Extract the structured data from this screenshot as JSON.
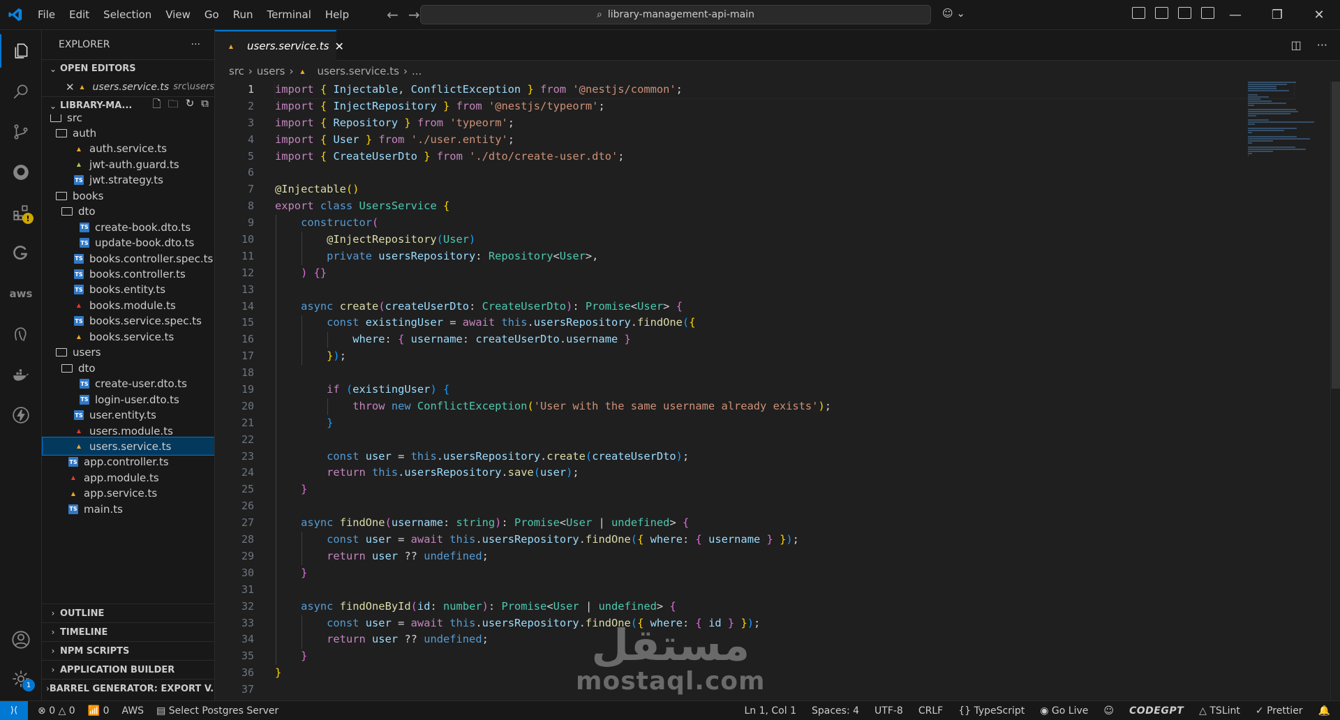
{
  "menu": [
    "File",
    "Edit",
    "Selection",
    "View",
    "Go",
    "Run",
    "Terminal",
    "Help"
  ],
  "command_center": {
    "text": "library-management-api-main"
  },
  "sidebar": {
    "title": "EXPLORER",
    "open_editors": {
      "label": "OPEN EDITORS",
      "items": [
        {
          "name": "users.service.ts",
          "path": "src\\users"
        }
      ]
    },
    "workspace_label": "LIBRARY-MA...",
    "tree": [
      {
        "label": "src",
        "kind": "folder",
        "depth": 0
      },
      {
        "label": "auth",
        "kind": "folder",
        "depth": 1
      },
      {
        "label": "auth.service.ts",
        "kind": "ng-y",
        "depth": 2
      },
      {
        "label": "jwt-auth.guard.ts",
        "kind": "guard",
        "depth": 2
      },
      {
        "label": "jwt.strategy.ts",
        "kind": "ts",
        "depth": 2
      },
      {
        "label": "books",
        "kind": "folder",
        "depth": 1
      },
      {
        "label": "dto",
        "kind": "folder",
        "depth": 2
      },
      {
        "label": "create-book.dto.ts",
        "kind": "ts",
        "depth": 3
      },
      {
        "label": "update-book.dto.ts",
        "kind": "ts",
        "depth": 3
      },
      {
        "label": "books.controller.spec.ts",
        "kind": "ts",
        "depth": 2
      },
      {
        "label": "books.controller.ts",
        "kind": "ts",
        "depth": 2
      },
      {
        "label": "books.entity.ts",
        "kind": "ts",
        "depth": 2
      },
      {
        "label": "books.module.ts",
        "kind": "ng-r",
        "depth": 2
      },
      {
        "label": "books.service.spec.ts",
        "kind": "ts",
        "depth": 2
      },
      {
        "label": "books.service.ts",
        "kind": "ng-y",
        "depth": 2
      },
      {
        "label": "users",
        "kind": "folder",
        "depth": 1
      },
      {
        "label": "dto",
        "kind": "folder",
        "depth": 2
      },
      {
        "label": "create-user.dto.ts",
        "kind": "ts",
        "depth": 3
      },
      {
        "label": "login-user.dto.ts",
        "kind": "ts",
        "depth": 3
      },
      {
        "label": "user.entity.ts",
        "kind": "ts",
        "depth": 2
      },
      {
        "label": "users.module.ts",
        "kind": "ng-r",
        "depth": 2
      },
      {
        "label": "users.service.ts",
        "kind": "ng-y",
        "depth": 2,
        "selected": true
      },
      {
        "label": "app.controller.ts",
        "kind": "ts",
        "depth": 1
      },
      {
        "label": "app.module.ts",
        "kind": "ng-r",
        "depth": 1
      },
      {
        "label": "app.service.ts",
        "kind": "ng-y",
        "depth": 1
      },
      {
        "label": "main.ts",
        "kind": "ts",
        "depth": 1
      }
    ],
    "sections": [
      "OUTLINE",
      "TIMELINE",
      "NPM SCRIPTS",
      "APPLICATION BUILDER",
      "BARREL GENERATOR: EXPORT V..."
    ]
  },
  "editor": {
    "tab": "users.service.ts",
    "breadcrumb": [
      "src",
      "users",
      "users.service.ts",
      "..."
    ],
    "current_line": 1,
    "lines": [
      [
        [
          "k",
          "import"
        ],
        [
          "p",
          " "
        ],
        [
          "b1",
          "{"
        ],
        [
          "p",
          " "
        ],
        [
          "v",
          "Injectable"
        ],
        [
          "p",
          ", "
        ],
        [
          "v",
          "ConflictException"
        ],
        [
          "p",
          " "
        ],
        [
          "b1",
          "}"
        ],
        [
          "p",
          " "
        ],
        [
          "k",
          "from"
        ],
        [
          "p",
          " "
        ],
        [
          "s",
          "'@nestjs/common'"
        ],
        [
          "p",
          ";"
        ]
      ],
      [
        [
          "k",
          "import"
        ],
        [
          "p",
          " "
        ],
        [
          "b1",
          "{"
        ],
        [
          "p",
          " "
        ],
        [
          "v",
          "InjectRepository"
        ],
        [
          "p",
          " "
        ],
        [
          "b1",
          "}"
        ],
        [
          "p",
          " "
        ],
        [
          "k",
          "from"
        ],
        [
          "p",
          " "
        ],
        [
          "s",
          "'@nestjs/typeorm'"
        ],
        [
          "p",
          ";"
        ]
      ],
      [
        [
          "k",
          "import"
        ],
        [
          "p",
          " "
        ],
        [
          "b1",
          "{"
        ],
        [
          "p",
          " "
        ],
        [
          "v",
          "Repository"
        ],
        [
          "p",
          " "
        ],
        [
          "b1",
          "}"
        ],
        [
          "p",
          " "
        ],
        [
          "k",
          "from"
        ],
        [
          "p",
          " "
        ],
        [
          "s",
          "'typeorm'"
        ],
        [
          "p",
          ";"
        ]
      ],
      [
        [
          "k",
          "import"
        ],
        [
          "p",
          " "
        ],
        [
          "b1",
          "{"
        ],
        [
          "p",
          " "
        ],
        [
          "v",
          "User"
        ],
        [
          "p",
          " "
        ],
        [
          "b1",
          "}"
        ],
        [
          "p",
          " "
        ],
        [
          "k",
          "from"
        ],
        [
          "p",
          " "
        ],
        [
          "s",
          "'./user.entity'"
        ],
        [
          "p",
          ";"
        ]
      ],
      [
        [
          "k",
          "import"
        ],
        [
          "p",
          " "
        ],
        [
          "b1",
          "{"
        ],
        [
          "p",
          " "
        ],
        [
          "v",
          "CreateUserDto"
        ],
        [
          "p",
          " "
        ],
        [
          "b1",
          "}"
        ],
        [
          "p",
          " "
        ],
        [
          "k",
          "from"
        ],
        [
          "p",
          " "
        ],
        [
          "s",
          "'./dto/create-user.dto'"
        ],
        [
          "p",
          ";"
        ]
      ],
      [],
      [
        [
          "f",
          "@Injectable"
        ],
        [
          "b1",
          "()"
        ]
      ],
      [
        [
          "k",
          "export"
        ],
        [
          "p",
          " "
        ],
        [
          "kw",
          "class"
        ],
        [
          "p",
          " "
        ],
        [
          "t",
          "UsersService"
        ],
        [
          "p",
          " "
        ],
        [
          "b1",
          "{"
        ]
      ],
      [
        [
          "p",
          "    "
        ],
        [
          "kw",
          "constructor"
        ],
        [
          "b2",
          "("
        ]
      ],
      [
        [
          "p",
          "        "
        ],
        [
          "f",
          "@InjectRepository"
        ],
        [
          "b3",
          "("
        ],
        [
          "t",
          "User"
        ],
        [
          "b3",
          ")"
        ]
      ],
      [
        [
          "p",
          "        "
        ],
        [
          "kw",
          "private"
        ],
        [
          "p",
          " "
        ],
        [
          "v",
          "usersRepository"
        ],
        [
          "p",
          ": "
        ],
        [
          "t",
          "Repository"
        ],
        [
          "p",
          "<"
        ],
        [
          "t",
          "User"
        ],
        [
          "p",
          ">,"
        ]
      ],
      [
        [
          "p",
          "    "
        ],
        [
          "b2",
          ")"
        ],
        [
          "p",
          " "
        ],
        [
          "b2",
          "{}"
        ]
      ],
      [],
      [
        [
          "p",
          "    "
        ],
        [
          "kw",
          "async"
        ],
        [
          "p",
          " "
        ],
        [
          "f",
          "create"
        ],
        [
          "b2",
          "("
        ],
        [
          "v",
          "createUserDto"
        ],
        [
          "p",
          ": "
        ],
        [
          "t",
          "CreateUserDto"
        ],
        [
          "b2",
          ")"
        ],
        [
          "p",
          ": "
        ],
        [
          "t",
          "Promise"
        ],
        [
          "p",
          "<"
        ],
        [
          "t",
          "User"
        ],
        [
          "p",
          "> "
        ],
        [
          "b2",
          "{"
        ]
      ],
      [
        [
          "p",
          "        "
        ],
        [
          "kw",
          "const"
        ],
        [
          "p",
          " "
        ],
        [
          "v",
          "existingUser"
        ],
        [
          "p",
          " = "
        ],
        [
          "k",
          "await"
        ],
        [
          "p",
          " "
        ],
        [
          "kw",
          "this"
        ],
        [
          "p",
          "."
        ],
        [
          "v",
          "usersRepository"
        ],
        [
          "p",
          "."
        ],
        [
          "f",
          "findOne"
        ],
        [
          "b3",
          "("
        ],
        [
          "b1",
          "{"
        ]
      ],
      [
        [
          "p",
          "            "
        ],
        [
          "v",
          "where"
        ],
        [
          "p",
          ": "
        ],
        [
          "b2",
          "{"
        ],
        [
          "p",
          " "
        ],
        [
          "v",
          "username"
        ],
        [
          "p",
          ": "
        ],
        [
          "v",
          "createUserDto"
        ],
        [
          "p",
          "."
        ],
        [
          "v",
          "username"
        ],
        [
          "p",
          " "
        ],
        [
          "b2",
          "}"
        ]
      ],
      [
        [
          "p",
          "        "
        ],
        [
          "b1",
          "}"
        ],
        [
          "b3",
          ")"
        ],
        [
          "p",
          ";"
        ]
      ],
      [],
      [
        [
          "p",
          "        "
        ],
        [
          "k",
          "if"
        ],
        [
          "p",
          " "
        ],
        [
          "b3",
          "("
        ],
        [
          "v",
          "existingUser"
        ],
        [
          "b3",
          ")"
        ],
        [
          "p",
          " "
        ],
        [
          "b3",
          "{"
        ]
      ],
      [
        [
          "p",
          "            "
        ],
        [
          "k",
          "throw"
        ],
        [
          "p",
          " "
        ],
        [
          "kw",
          "new"
        ],
        [
          "p",
          " "
        ],
        [
          "t",
          "ConflictException"
        ],
        [
          "b1",
          "("
        ],
        [
          "s",
          "'User with the same username already exists'"
        ],
        [
          "b1",
          ")"
        ],
        [
          "p",
          ";"
        ]
      ],
      [
        [
          "p",
          "        "
        ],
        [
          "b3",
          "}"
        ]
      ],
      [],
      [
        [
          "p",
          "        "
        ],
        [
          "kw",
          "const"
        ],
        [
          "p",
          " "
        ],
        [
          "v",
          "user"
        ],
        [
          "p",
          " = "
        ],
        [
          "kw",
          "this"
        ],
        [
          "p",
          "."
        ],
        [
          "v",
          "usersRepository"
        ],
        [
          "p",
          "."
        ],
        [
          "f",
          "create"
        ],
        [
          "b3",
          "("
        ],
        [
          "v",
          "createUserDto"
        ],
        [
          "b3",
          ")"
        ],
        [
          "p",
          ";"
        ]
      ],
      [
        [
          "p",
          "        "
        ],
        [
          "k",
          "return"
        ],
        [
          "p",
          " "
        ],
        [
          "kw",
          "this"
        ],
        [
          "p",
          "."
        ],
        [
          "v",
          "usersRepository"
        ],
        [
          "p",
          "."
        ],
        [
          "f",
          "save"
        ],
        [
          "b3",
          "("
        ],
        [
          "v",
          "user"
        ],
        [
          "b3",
          ")"
        ],
        [
          "p",
          ";"
        ]
      ],
      [
        [
          "p",
          "    "
        ],
        [
          "b2",
          "}"
        ]
      ],
      [],
      [
        [
          "p",
          "    "
        ],
        [
          "kw",
          "async"
        ],
        [
          "p",
          " "
        ],
        [
          "f",
          "findOne"
        ],
        [
          "b2",
          "("
        ],
        [
          "v",
          "username"
        ],
        [
          "p",
          ": "
        ],
        [
          "t",
          "string"
        ],
        [
          "b2",
          ")"
        ],
        [
          "p",
          ": "
        ],
        [
          "t",
          "Promise"
        ],
        [
          "p",
          "<"
        ],
        [
          "t",
          "User"
        ],
        [
          "p",
          " | "
        ],
        [
          "t",
          "undefined"
        ],
        [
          "p",
          "> "
        ],
        [
          "b2",
          "{"
        ]
      ],
      [
        [
          "p",
          "        "
        ],
        [
          "kw",
          "const"
        ],
        [
          "p",
          " "
        ],
        [
          "v",
          "user"
        ],
        [
          "p",
          " = "
        ],
        [
          "k",
          "await"
        ],
        [
          "p",
          " "
        ],
        [
          "kw",
          "this"
        ],
        [
          "p",
          "."
        ],
        [
          "v",
          "usersRepository"
        ],
        [
          "p",
          "."
        ],
        [
          "f",
          "findOne"
        ],
        [
          "b3",
          "("
        ],
        [
          "b1",
          "{"
        ],
        [
          "p",
          " "
        ],
        [
          "v",
          "where"
        ],
        [
          "p",
          ": "
        ],
        [
          "b2",
          "{"
        ],
        [
          "p",
          " "
        ],
        [
          "v",
          "username"
        ],
        [
          "p",
          " "
        ],
        [
          "b2",
          "}"
        ],
        [
          "p",
          " "
        ],
        [
          "b1",
          "}"
        ],
        [
          "b3",
          ")"
        ],
        [
          "p",
          ";"
        ]
      ],
      [
        [
          "p",
          "        "
        ],
        [
          "k",
          "return"
        ],
        [
          "p",
          " "
        ],
        [
          "v",
          "user"
        ],
        [
          "p",
          " ?? "
        ],
        [
          "kw",
          "undefined"
        ],
        [
          "p",
          ";"
        ]
      ],
      [
        [
          "p",
          "    "
        ],
        [
          "b2",
          "}"
        ]
      ],
      [],
      [
        [
          "p",
          "    "
        ],
        [
          "kw",
          "async"
        ],
        [
          "p",
          " "
        ],
        [
          "f",
          "findOneById"
        ],
        [
          "b2",
          "("
        ],
        [
          "v",
          "id"
        ],
        [
          "p",
          ": "
        ],
        [
          "t",
          "number"
        ],
        [
          "b2",
          ")"
        ],
        [
          "p",
          ": "
        ],
        [
          "t",
          "Promise"
        ],
        [
          "p",
          "<"
        ],
        [
          "t",
          "User"
        ],
        [
          "p",
          " | "
        ],
        [
          "t",
          "undefined"
        ],
        [
          "p",
          "> "
        ],
        [
          "b2",
          "{"
        ]
      ],
      [
        [
          "p",
          "        "
        ],
        [
          "kw",
          "const"
        ],
        [
          "p",
          " "
        ],
        [
          "v",
          "user"
        ],
        [
          "p",
          " = "
        ],
        [
          "k",
          "await"
        ],
        [
          "p",
          " "
        ],
        [
          "kw",
          "this"
        ],
        [
          "p",
          "."
        ],
        [
          "v",
          "usersRepository"
        ],
        [
          "p",
          "."
        ],
        [
          "f",
          "findOne"
        ],
        [
          "b3",
          "("
        ],
        [
          "b1",
          "{"
        ],
        [
          "p",
          " "
        ],
        [
          "v",
          "where"
        ],
        [
          "p",
          ": "
        ],
        [
          "b2",
          "{"
        ],
        [
          "p",
          " "
        ],
        [
          "v",
          "id"
        ],
        [
          "p",
          " "
        ],
        [
          "b2",
          "}"
        ],
        [
          "p",
          " "
        ],
        [
          "b1",
          "}"
        ],
        [
          "b3",
          ")"
        ],
        [
          "p",
          ";"
        ]
      ],
      [
        [
          "p",
          "        "
        ],
        [
          "k",
          "return"
        ],
        [
          "p",
          " "
        ],
        [
          "v",
          "user"
        ],
        [
          "p",
          " ?? "
        ],
        [
          "kw",
          "undefined"
        ],
        [
          "p",
          ";"
        ]
      ],
      [
        [
          "p",
          "    "
        ],
        [
          "b2",
          "}"
        ]
      ],
      [
        [
          "b1",
          "}"
        ]
      ],
      []
    ]
  },
  "watermark": {
    "arabic": "مستقل",
    "latin": "mostaql.com"
  },
  "statusbar": {
    "errors": "0",
    "warnings": "0",
    "ports": "0",
    "aws": "AWS",
    "postgres": "Select Postgres Server",
    "position": "Ln 1, Col 1",
    "spaces": "Spaces: 4",
    "encoding": "UTF-8",
    "eol": "CRLF",
    "language": "TypeScript",
    "golive": "Go Live",
    "codegpt": "CODEGPT",
    "tslint": "TSLint",
    "prettier": "Prettier"
  },
  "accounts_badge": "1",
  "colors": {
    "accent": "#0078d4",
    "selection": "#04395e"
  }
}
